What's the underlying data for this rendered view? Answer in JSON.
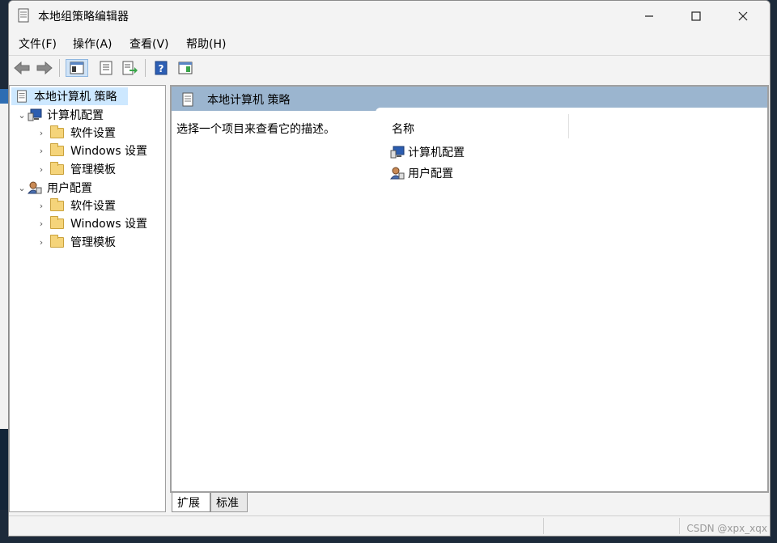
{
  "window": {
    "title": "本地组策略编辑器",
    "controls": {
      "minimize": "—",
      "maximize": "☐",
      "close": "✕"
    }
  },
  "menu": [
    {
      "label": "文件(F)"
    },
    {
      "label": "操作(A)"
    },
    {
      "label": "查看(V)"
    },
    {
      "label": "帮助(H)"
    }
  ],
  "toolbar": {
    "back_icon": "arrow-left-icon",
    "forward_icon": "arrow-right-icon",
    "show_hide_tree_icon": "show-hide-tree-icon",
    "properties_icon": "properties-icon",
    "export_list_icon": "export-list-icon",
    "help_icon": "help-icon",
    "action_pane_icon": "action-pane-icon"
  },
  "tree": {
    "root": "本地计算机 策略",
    "nodes": [
      {
        "label": "计算机配置",
        "children": [
          "软件设置",
          "Windows 设置",
          "管理模板"
        ]
      },
      {
        "label": "用户配置",
        "children": [
          "软件设置",
          "Windows 设置",
          "管理模板"
        ]
      }
    ]
  },
  "details": {
    "header": "本地计算机 策略",
    "description": "选择一个项目来查看它的描述。",
    "column_name": "名称",
    "items": [
      "计算机配置",
      "用户配置"
    ]
  },
  "tabs": [
    {
      "label": "扩展",
      "active": true
    },
    {
      "label": "标准",
      "active": false
    }
  ],
  "watermark": "CSDN @xpx_xqx",
  "colors": {
    "header_band": "#9bb5cf",
    "selection": "#cde8ff",
    "folder": "#f5d47a"
  }
}
